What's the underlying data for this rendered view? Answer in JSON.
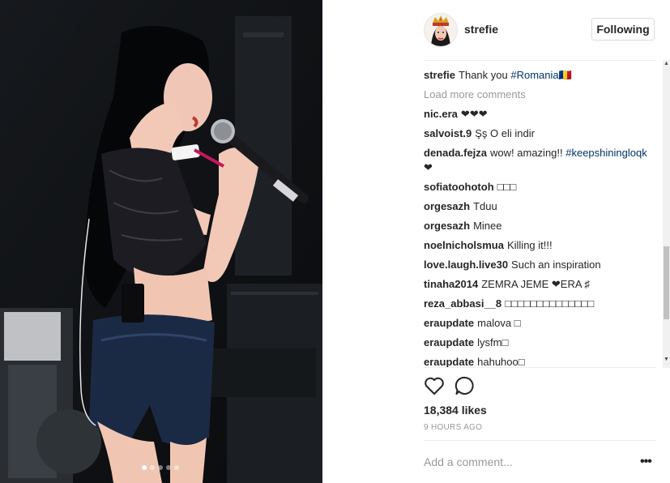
{
  "post": {
    "username": "strefie",
    "follow_label": "Following",
    "caption": {
      "user": "strefie",
      "text": "Thank you ",
      "hashtag": "#Romania🇷🇴"
    },
    "load_more_label": "Load more comments",
    "comments": [
      {
        "user": "nic.era",
        "text": "❤❤❤"
      },
      {
        "user": "salvoist.9",
        "text": "Şş O eli indir"
      },
      {
        "user": "denada.fejza",
        "text": "wow! amazing!! ",
        "hashtag": "#keepshiningloqk",
        "suffix": " ❤"
      },
      {
        "user": "sofiatoohotoh",
        "text": "□□□"
      },
      {
        "user": "orgesazh",
        "text": "Tduu"
      },
      {
        "user": "orgesazh",
        "text": "Minee"
      },
      {
        "user": "noelnicholsmua",
        "text": "Killing it!!!"
      },
      {
        "user": "love.laugh.live30",
        "text": "Such an inspiration"
      },
      {
        "user": "tinaha2014",
        "text": "ZEMRA JEME ❤ERA ♯"
      },
      {
        "user": "reza_abbasi__8",
        "text": "□□□□□□□□□□□□□□"
      },
      {
        "user": "eraupdate",
        "text": "malova □"
      },
      {
        "user": "eraupdate",
        "text": "lysfm□"
      },
      {
        "user": "eraupdate",
        "text": "hahuhoo□"
      }
    ],
    "likes": "18,384 likes",
    "time_ago": "9 HOURS AGO",
    "add_comment_placeholder": "Add a comment...",
    "more_options": "•••"
  },
  "carousel": {
    "count": 5,
    "active": 0
  },
  "icons": {
    "like": "heart-icon",
    "comment": "comment-bubble-icon",
    "avatar": "crowned-avatar-icon"
  },
  "colors": {
    "hashtag": "#003569",
    "muted": "#999999",
    "text": "#262626",
    "border": "#dbdbdb"
  }
}
